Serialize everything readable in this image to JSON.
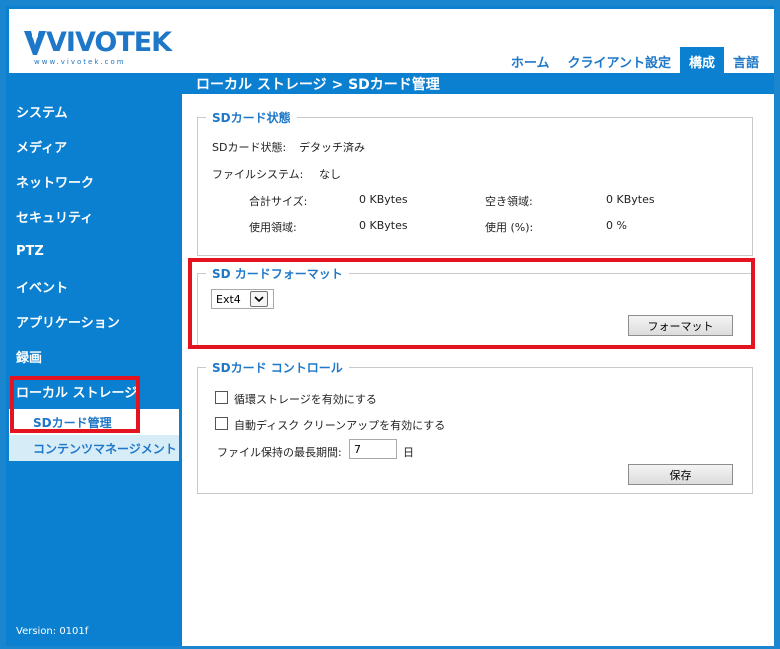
{
  "header": {
    "logo_text": "VIVOTEK",
    "logo_url": "www.vivotek.com",
    "nav": [
      {
        "label": "ホーム",
        "active": false
      },
      {
        "label": "クライアント設定",
        "active": false
      },
      {
        "label": "構成",
        "active": true
      },
      {
        "label": "言語",
        "active": false
      }
    ]
  },
  "breadcrumb": "ローカル ストレージ  > SDカード管理",
  "sidebar": {
    "items": [
      "システム",
      "メディア",
      "ネットワーク",
      "セキュリティ",
      "PTZ",
      "イベント",
      "アプリケーション",
      "録画",
      "ローカル ストレージ"
    ],
    "sub_items": [
      "SDカード管理",
      "コンテンツマネージメント"
    ],
    "version": "Version: 0101f"
  },
  "sd_status": {
    "legend": "SDカード状態",
    "state_label": "SDカード状態:",
    "state_value": "デタッチ済み",
    "fs_label": "ファイルシステム:",
    "fs_value": "なし",
    "total_label": "合計サイズ:",
    "total_value": "0  KBytes",
    "free_label": "空き領域:",
    "free_value": "0  KBytes",
    "used_label": "使用領域:",
    "used_value": "0  KBytes",
    "used_pct_label": "使用 (%):",
    "used_pct_value": "0 %"
  },
  "sd_format": {
    "legend": "SD カードフォーマット",
    "selected": "Ext4",
    "button": "フォーマット"
  },
  "sd_control": {
    "legend": "SDカード コントロール",
    "cyclic_label": "循環ストレージを有効にする",
    "cyclic_checked": false,
    "cleanup_label": "自動ディスク クリーンアップを有効にする",
    "cleanup_checked": false,
    "retention_label": "ファイル保持の最長期間:",
    "retention_value": "7",
    "retention_unit": "日",
    "save_button": "保存"
  },
  "colors": {
    "brand_blue": "#0b7fd0",
    "link_blue": "#1f77c8",
    "highlight_red": "#e3141f"
  }
}
